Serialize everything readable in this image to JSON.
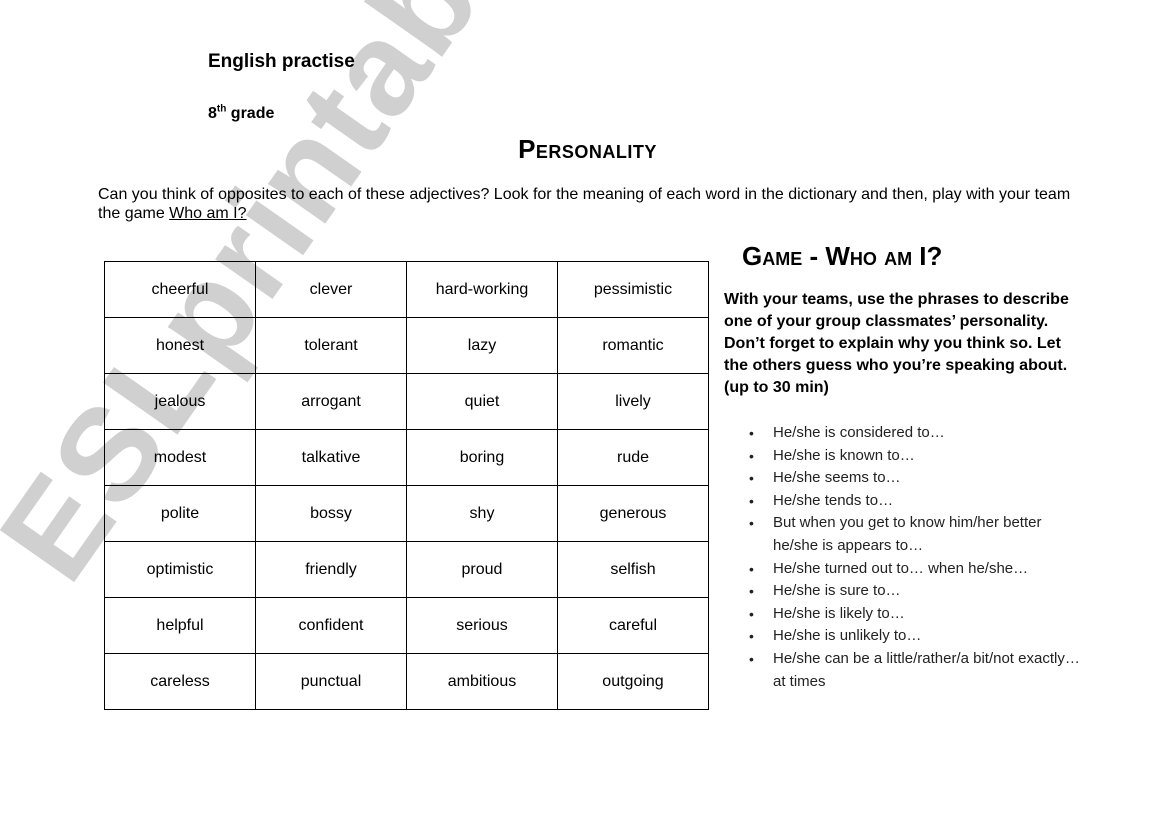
{
  "watermark": "ESLprintables.com",
  "header": {
    "heading": "English practise",
    "grade_number": "8",
    "grade_suffix": "th",
    "grade_label": " grade",
    "title": "Personality"
  },
  "instructions": {
    "text": "Can you think of opposites to each of these adjectives? Look for the meaning of each word in the dictionary and then, play with your team the game ",
    "link_text": "Who am I?"
  },
  "adjectives": [
    [
      "cheerful",
      "clever",
      "hard-working",
      "pessimistic"
    ],
    [
      "honest",
      "tolerant",
      "lazy",
      "romantic"
    ],
    [
      "jealous",
      "arrogant",
      "quiet",
      "lively"
    ],
    [
      "modest",
      "talkative",
      "boring",
      "rude"
    ],
    [
      "polite",
      "bossy",
      "shy",
      "generous"
    ],
    [
      "optimistic",
      "friendly",
      "proud",
      "selfish"
    ],
    [
      "helpful",
      "confident",
      "serious",
      "careful"
    ],
    [
      "careless",
      "punctual",
      "ambitious",
      "outgoing"
    ]
  ],
  "game": {
    "title": "Game - Who am I?",
    "description": "With your teams, use the phrases to describe one of your group classmates’ personality. Don’t forget to explain why you think so. Let the others guess who you’re speaking about.   (up to 30 min)",
    "bullet_icon": "•",
    "phrases": [
      "He/she is considered to…",
      "He/she is known to…",
      "He/she seems to…",
      "He/she tends to…",
      "But when you get to know him/her better he/she is appears to…",
      "He/she turned out to… when he/she…",
      "He/she is sure to…",
      "He/she is likely to…",
      "He/she is unlikely to…",
      "He/she can be a little/rather/a bit/not exactly… at times"
    ]
  }
}
